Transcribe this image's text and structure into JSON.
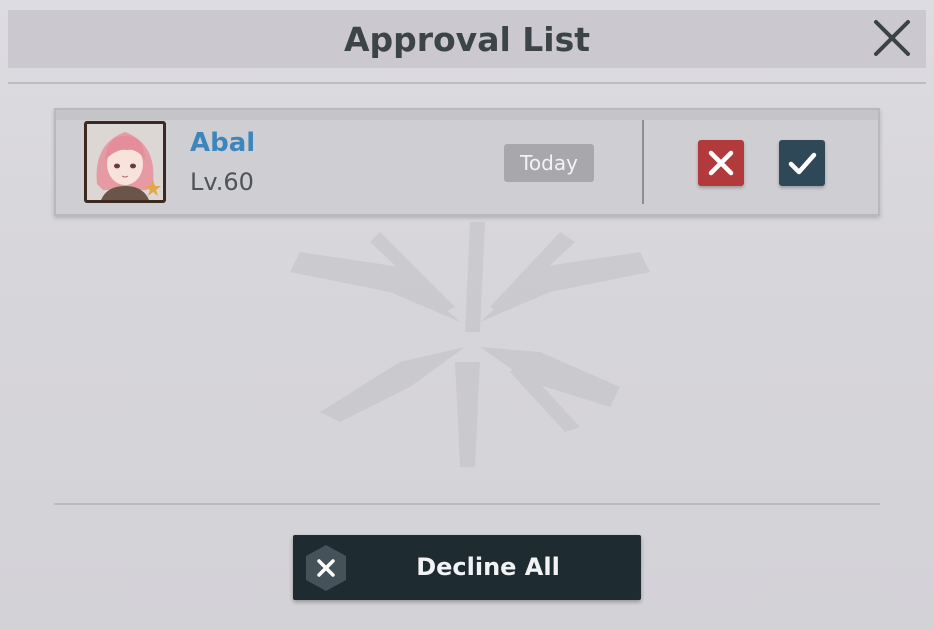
{
  "header": {
    "title": "Approval List",
    "close_icon": "close-icon"
  },
  "request": {
    "name": "Abal",
    "level": "Lv.60",
    "time": "Today",
    "avatar_icon": "player-avatar",
    "reject_icon": "x-icon",
    "accept_icon": "check-icon"
  },
  "footer": {
    "decline_all_label": "Decline All",
    "decline_icon": "x-icon"
  },
  "colors": {
    "name": "#3d86bd",
    "reject": "#b33a3c",
    "accept": "#2f4857",
    "decline_button": "#1e2b31"
  }
}
